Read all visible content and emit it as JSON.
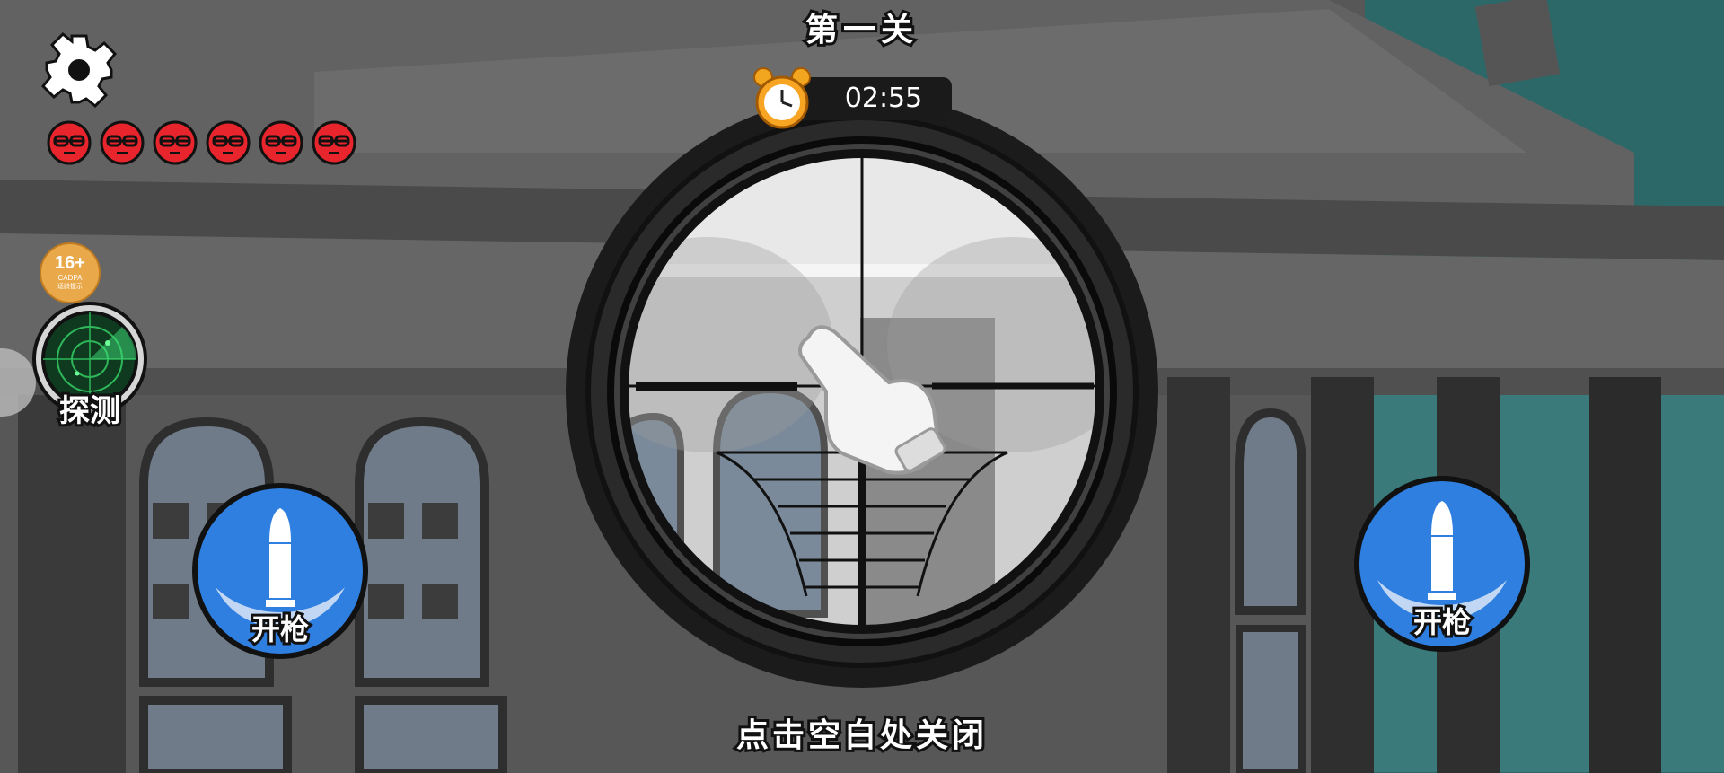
{
  "level": {
    "title": "第一关"
  },
  "timer": {
    "value": "02:55",
    "icon": "alarm-clock-icon"
  },
  "settings": {
    "icon": "gear-icon"
  },
  "lives": {
    "count": 6,
    "icon": "red-face-icon",
    "color": "#e8242c"
  },
  "age_rating": {
    "label": "16+",
    "sub": "CADPA",
    "sub2": "适龄提示"
  },
  "radar": {
    "label": "探测",
    "icon": "radar-icon"
  },
  "fire_left": {
    "label": "开枪",
    "icon": "bullet-icon"
  },
  "fire_right": {
    "label": "开枪",
    "icon": "bullet-icon"
  },
  "hint": "点击空白处关闭",
  "scope": {
    "icon": "sniper-scope-icon"
  },
  "tutorial": {
    "icon": "pointing-hand-icon"
  },
  "colors": {
    "fire_button": "#2f7fe0",
    "sky": "#2c6a6a",
    "building": "#5a5a5a"
  }
}
